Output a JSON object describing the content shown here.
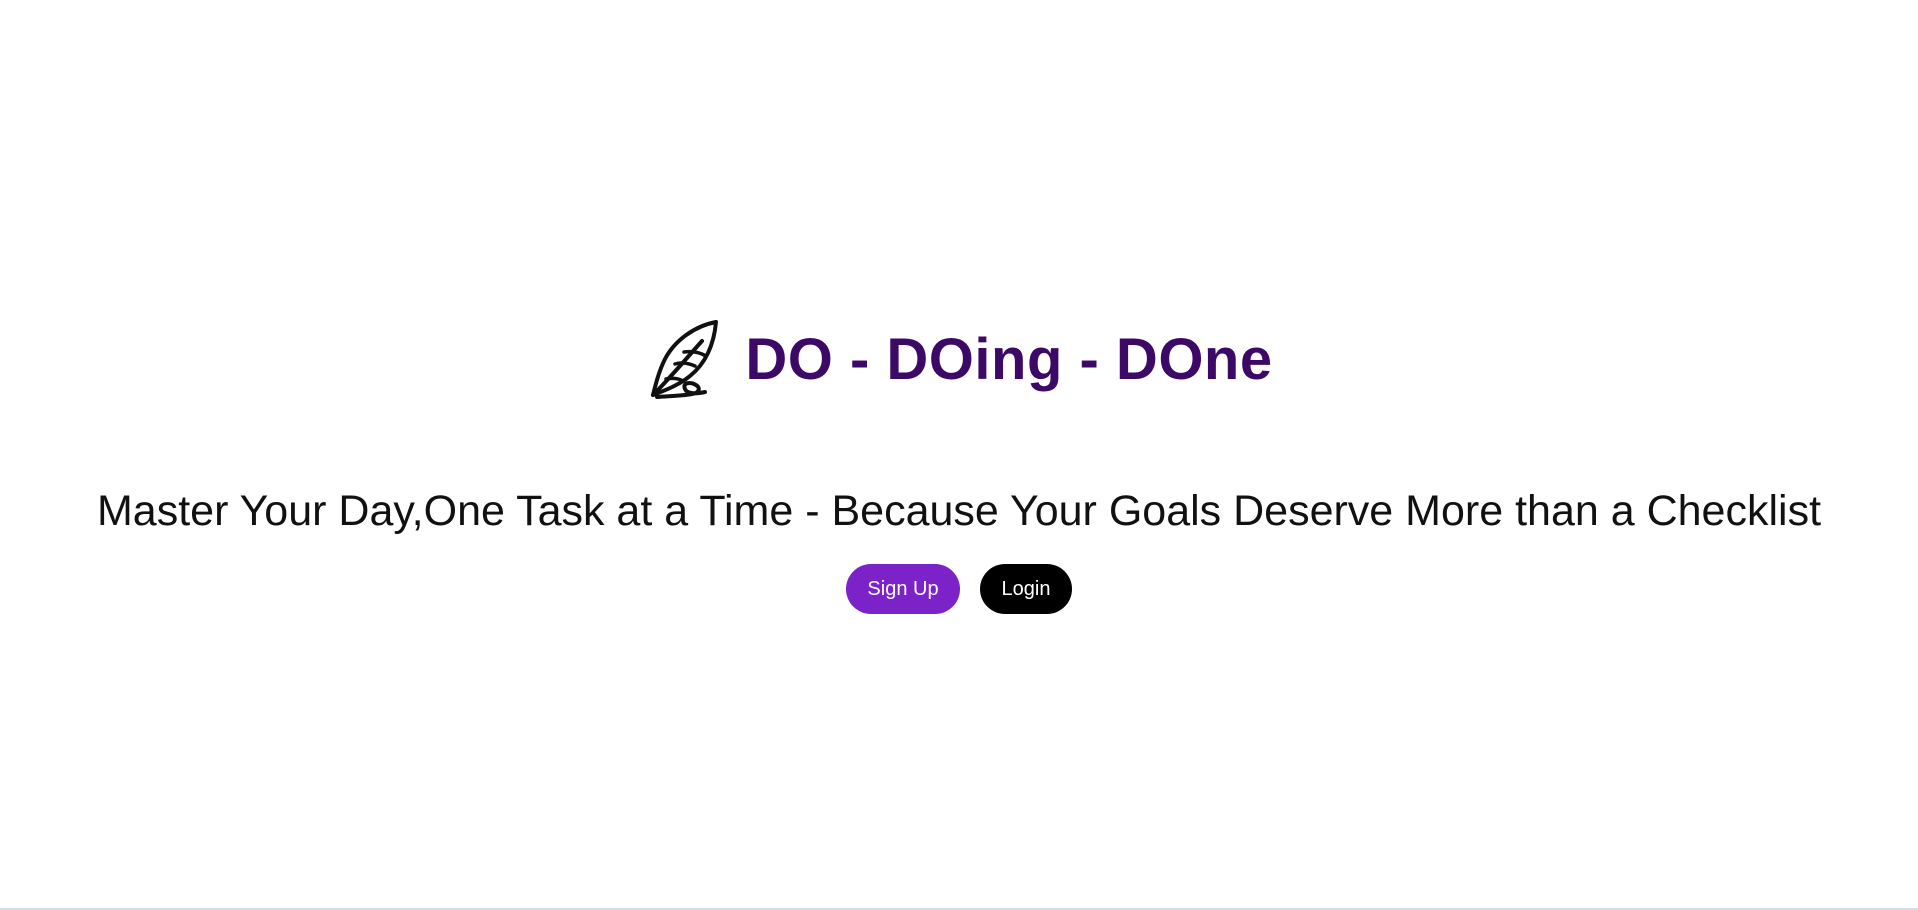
{
  "brand": {
    "title": "DO - DOing - DOne",
    "icon": "feather-quill-icon",
    "title_color": "#3c0a66"
  },
  "hero": {
    "tagline": "Master Your Day,One Task at a Time - Because Your Goals Deserve More than a Checklist"
  },
  "actions": {
    "signup_label": "Sign Up",
    "login_label": "Login",
    "signup_color": "#7b22c9",
    "login_color": "#000000"
  }
}
